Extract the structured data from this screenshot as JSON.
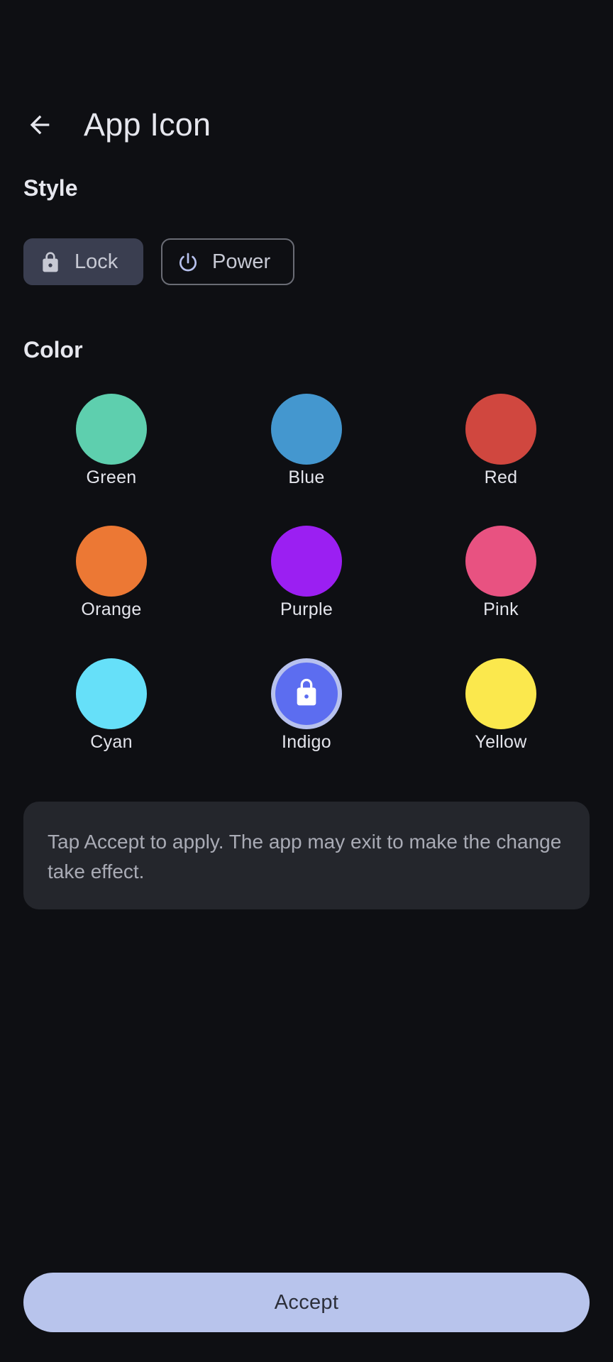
{
  "header": {
    "title": "App Icon",
    "back_icon": "arrow-back-icon"
  },
  "style_section": {
    "title": "Style",
    "options": [
      {
        "label": "Lock",
        "icon": "lock-icon",
        "selected": true
      },
      {
        "label": "Power",
        "icon": "power-icon",
        "selected": false
      }
    ]
  },
  "color_section": {
    "title": "Color",
    "options": [
      {
        "label": "Green",
        "color": "#5ecfae",
        "selected": false
      },
      {
        "label": "Blue",
        "color": "#4497cf",
        "selected": false
      },
      {
        "label": "Red",
        "color": "#d0473f",
        "selected": false
      },
      {
        "label": "Orange",
        "color": "#ec7834",
        "selected": false
      },
      {
        "label": "Purple",
        "color": "#9b1ff2",
        "selected": false
      },
      {
        "label": "Pink",
        "color": "#e85281",
        "selected": false
      },
      {
        "label": "Cyan",
        "color": "#66e0f9",
        "selected": false
      },
      {
        "label": "Indigo",
        "color": "#5c6df0",
        "selected": true
      },
      {
        "label": "Yellow",
        "color": "#fbe84d",
        "selected": false
      }
    ]
  },
  "info": {
    "text": "Tap Accept to apply. The app may exit to make the change take effect."
  },
  "actions": {
    "accept_label": "Accept"
  }
}
